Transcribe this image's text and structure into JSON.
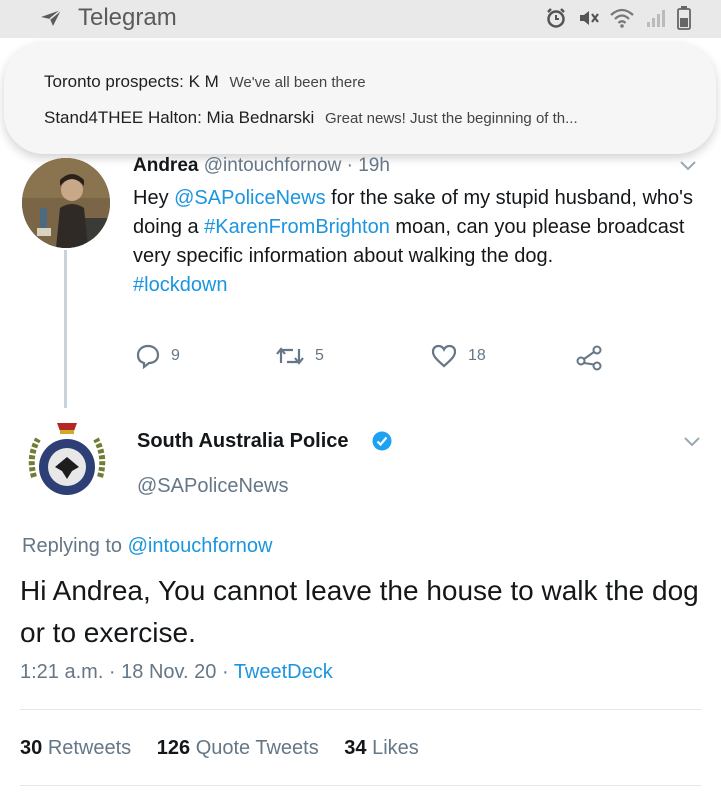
{
  "status_bar": {
    "app_name": "Telegram",
    "icons": [
      "telegram-arrow-icon",
      "alarm-icon",
      "mute-icon",
      "wifi-icon",
      "signal-icon",
      "battery-icon"
    ]
  },
  "notifications": [
    {
      "title": "Toronto prospects: K M",
      "preview": "We've all been there"
    },
    {
      "title": "Stand4THEE Halton: Mia Bednarski",
      "preview": "Great news! Just the beginning of th..."
    }
  ],
  "tweet1": {
    "name": "Andrea",
    "handle": "@intouchfornow",
    "time": "· 19h",
    "text_parts": [
      "Hey ",
      "@SAPoliceNews",
      " for the sake of my stupid husband, who's doing a ",
      "#KarenFromBrighton",
      " moan, can you please broadcast very specific information about walking the dog.",
      "#lockdown"
    ],
    "replies": "9",
    "retweets": "5",
    "likes": "18"
  },
  "tweet2": {
    "name": "South Australia Police",
    "handle": "@SAPoliceNews",
    "replying_prefix": "Replying to ",
    "replying_to": "@intouchfornow",
    "text": "Hi Andrea, You cannot leave the house to walk the dog or to exercise.",
    "timestamp": "1:21 a.m. · 18 Nov. 20 · ",
    "source": "TweetDeck",
    "retweets_count": "30",
    "retweets_label": "Retweets",
    "quotes_count": "126",
    "quotes_label": "Quote Tweets",
    "likes_count": "34",
    "likes_label": "Likes"
  },
  "colors": {
    "link": "#1b95e0",
    "secondary_text": "#657786",
    "primary_text": "#14171a",
    "verified": "#1da1f2",
    "status_bar_bg": "#e9e9e9"
  }
}
